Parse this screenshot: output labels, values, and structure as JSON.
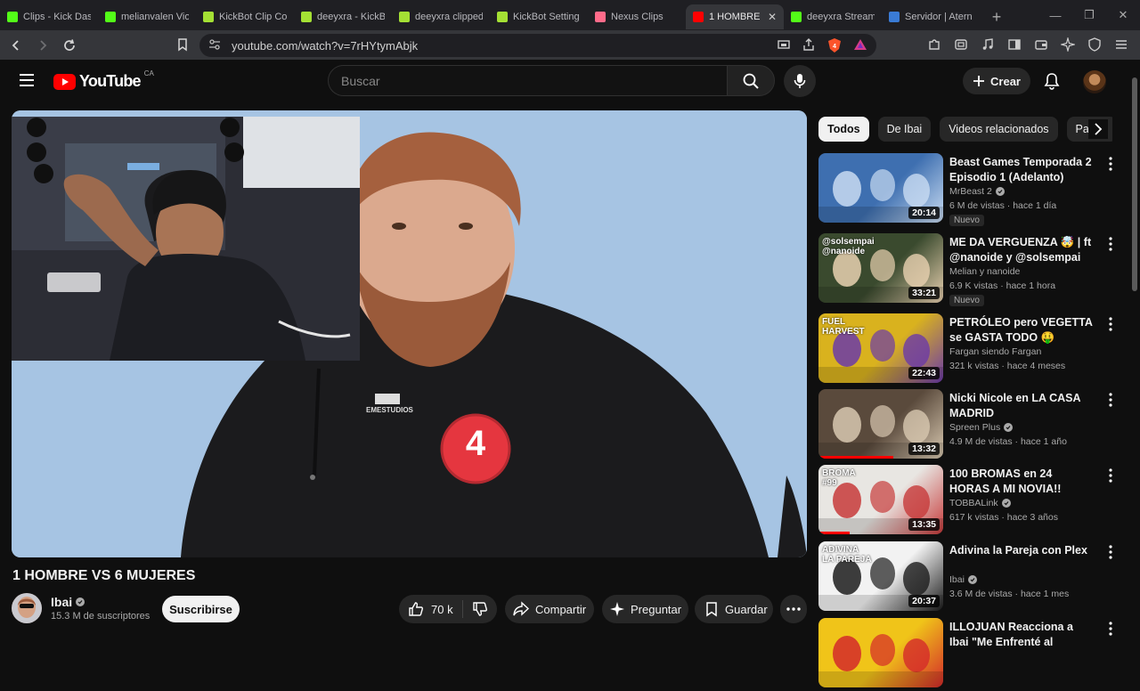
{
  "browser": {
    "tabs": [
      {
        "title": "Clips - Kick Das",
        "icon": "kick-icon",
        "color": "#53fc18"
      },
      {
        "title": "melianvalen Vio",
        "icon": "kick-icon",
        "color": "#53fc18"
      },
      {
        "title": "KickBot Clip Co",
        "icon": "kickbot-icon",
        "color": "#a4e034"
      },
      {
        "title": "deeyxra - KickB",
        "icon": "kickbot-icon",
        "color": "#a4e034"
      },
      {
        "title": "deeyxra clipped",
        "icon": "kickbot-icon",
        "color": "#a4e034"
      },
      {
        "title": "KickBot Setting",
        "icon": "kickbot-icon",
        "color": "#a4e034"
      },
      {
        "title": "Nexus Clips",
        "icon": "nexus-icon",
        "color": "#ff6b8a"
      },
      {
        "title": "1 HOMBRE",
        "icon": "youtube-icon",
        "color": "#ff0000",
        "active": true
      },
      {
        "title": "deeyxra Stream",
        "icon": "kick-icon",
        "color": "#53fc18"
      },
      {
        "title": "Servidor | Atern",
        "icon": "aternos-icon",
        "color": "#3a7bd5"
      }
    ],
    "url": "youtube.com/watch?v=7rHYtymAbjk"
  },
  "header": {
    "logo_text": "YouTube",
    "country": "CA",
    "search_placeholder": "Buscar",
    "create_label": "Crear"
  },
  "video": {
    "title": "1 HOMBRE VS 6 MUJERES",
    "channel": "Ibai",
    "subscribers": "15.3 M de suscriptores",
    "subscribe_label": "Suscribirse",
    "likes": "70 k",
    "share_label": "Compartir",
    "ask_label": "Preguntar",
    "save_label": "Guardar",
    "shirt_number": "4",
    "shirt_brand": "EMESTUDIOS"
  },
  "chips": [
    "Todos",
    "De Ibai",
    "Videos relacionados",
    "Para ti"
  ],
  "recommendations": [
    {
      "title": "Beast Games Temporada 2 Episodio 1 (Adelanto)",
      "channel": "MrBeast 2",
      "verified": true,
      "meta": "6 M de vistas · hace 1 día",
      "badge": "Nuevo",
      "duration": "20:14",
      "bg": "#3e6fb0",
      "accent": "#c9dcf2",
      "progress": 0
    },
    {
      "title": "ME DA VERGUENZA 🤯 | ft @nanoide  y @solsempai",
      "channel": "Melian y nanoide",
      "verified": false,
      "meta": "6.9 K vistas · hace 1 hora",
      "badge": "Nuevo",
      "duration": "33:21",
      "bg": "#3a4a2e",
      "accent": "#e9d1b0",
      "progress": 0
    },
    {
      "title": "PETRÓLEO pero VEGETTA se GASTA TODO 🤑 MEJORES ...",
      "channel": "Fargan siendo Fargan",
      "verified": false,
      "meta": "321 k vistas · hace 4 meses",
      "badge": "",
      "duration": "22:43",
      "bg": "#d9b21e",
      "accent": "#6b3aa8",
      "progress": 0
    },
    {
      "title": "Nicki Nicole en LA CASA MADRID",
      "channel": "Spreen Plus",
      "verified": true,
      "meta": "4.9 M de vistas · hace 1 año",
      "badge": "",
      "duration": "13:32",
      "bg": "#5a4a3c",
      "accent": "#d8c8b0",
      "progress": 0.6
    },
    {
      "title": "100 BROMAS en 24 HORAS A MI NOVIA!!",
      "channel": "TOBBALink",
      "verified": true,
      "meta": "617 k vistas · hace 3 años",
      "badge": "",
      "duration": "13:35",
      "bg": "#e8e6e2",
      "accent": "#c73a3a",
      "progress": 0.25
    },
    {
      "title": "Adivina la Pareja con Plex",
      "channel": "Ibai",
      "verified": true,
      "meta": "3.6 M de vistas · hace 1 mes",
      "badge": "",
      "duration": "20:37",
      "bg": "#f2f2f2",
      "accent": "#1c1c1c",
      "progress": 0
    },
    {
      "title": "ILLOJUAN Reacciona a Ibai \"Me Enfrenté al Detector de",
      "channel": "",
      "verified": false,
      "meta": "",
      "badge": "",
      "duration": "",
      "bg": "#f0c419",
      "accent": "#d42a2a",
      "progress": 0
    }
  ],
  "thumb_text": {
    "r2": "@solsempai",
    "r3a": "FUEL",
    "r3b": "HARVEST",
    "r5a": "BROMA",
    "r5b": "#99",
    "r6a": "ADIVINA",
    "r6b": "LA PAREJA",
    "r2b": "@nanoide"
  }
}
